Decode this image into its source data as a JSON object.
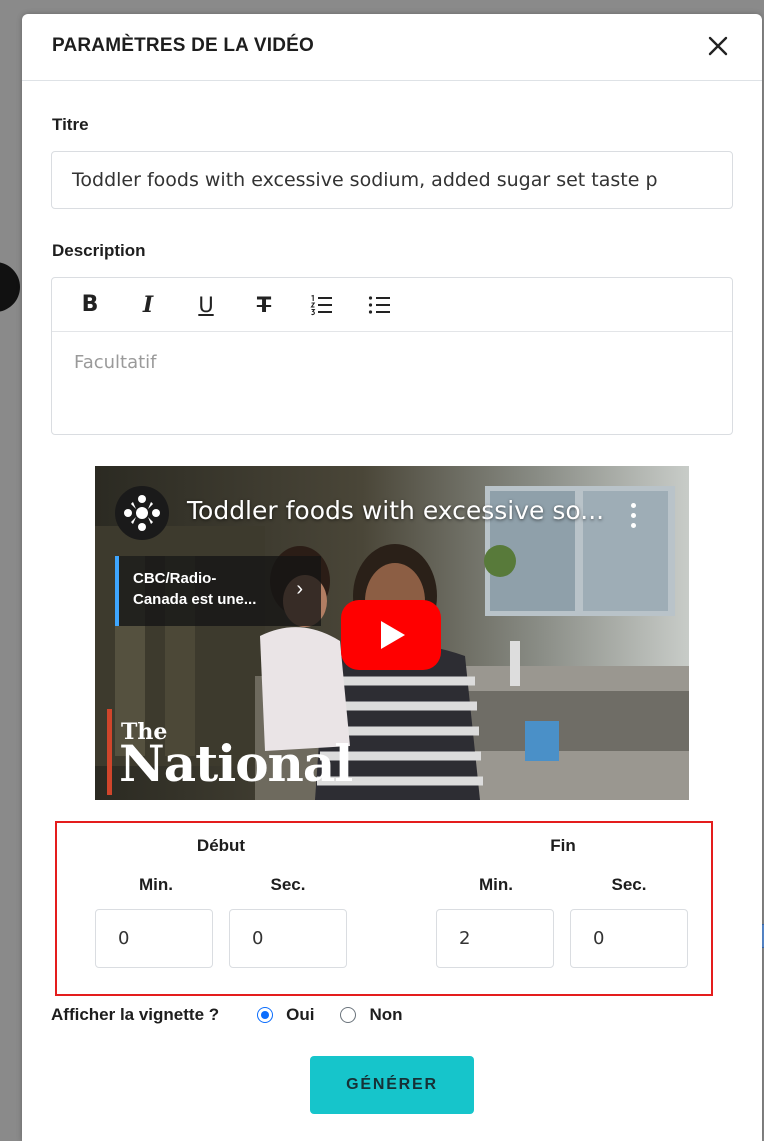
{
  "modal": {
    "title": "PARAMÈTRES DE LA VIDÉO",
    "close_icon": "close-icon"
  },
  "title_field": {
    "label": "Titre",
    "value": "Toddler foods with excessive sodium, added sugar set taste p"
  },
  "description_field": {
    "label": "Description",
    "toolbar": {
      "bold": "B",
      "italic": "I",
      "underline": "U",
      "strikethrough": "T",
      "ordered_list_icon": "ordered-list-icon",
      "bullet_list_icon": "bullet-list-icon"
    },
    "placeholder": "Facultatif"
  },
  "video": {
    "title": "Toddler foods with excessive so...",
    "info_card": "CBC/Radio-\nCanada est une...",
    "play_icon": "youtube-play-icon",
    "show_the": "The",
    "show_name": "National",
    "colors": {
      "play": "#ff0000",
      "card_accent": "#3ea6ff",
      "show_bar": "#d0452b"
    }
  },
  "timing": {
    "start_label": "Début",
    "end_label": "Fin",
    "start_min_label": "Min.",
    "start_sec_label": "Sec.",
    "end_min_label": "Min.",
    "end_sec_label": "Sec.",
    "start_min": "0",
    "start_sec": "0",
    "end_min": "2",
    "end_sec": "0"
  },
  "thumbnail": {
    "label": "Afficher la vignette ?",
    "options": [
      {
        "label": "Oui",
        "checked": true
      },
      {
        "label": "Non",
        "checked": false
      }
    ]
  },
  "generate_button": "GÉNÉRER",
  "colors": {
    "accent_button": "#16c5cb",
    "radio_checked": "#0d6efd",
    "highlight_border": "#e41d1d"
  }
}
